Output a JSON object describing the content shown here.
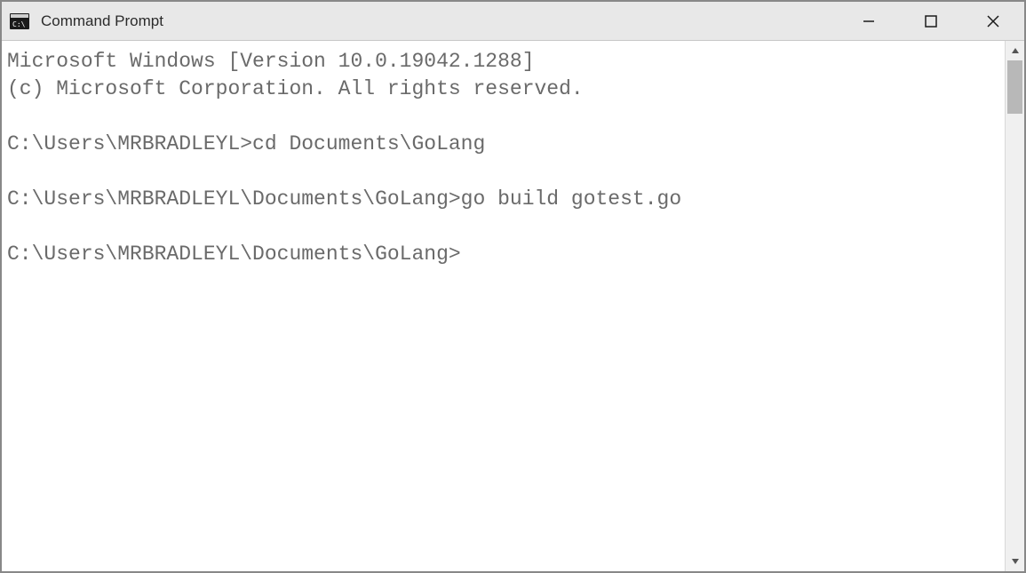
{
  "titlebar": {
    "title": "Command Prompt"
  },
  "terminal": {
    "lines": [
      "Microsoft Windows [Version 10.0.19042.1288]",
      "(c) Microsoft Corporation. All rights reserved.",
      "",
      "C:\\Users\\MRBRADLEYL>cd Documents\\GoLang",
      "",
      "C:\\Users\\MRBRADLEYL\\Documents\\GoLang>go build gotest.go",
      "",
      "C:\\Users\\MRBRADLEYL\\Documents\\GoLang>"
    ]
  }
}
